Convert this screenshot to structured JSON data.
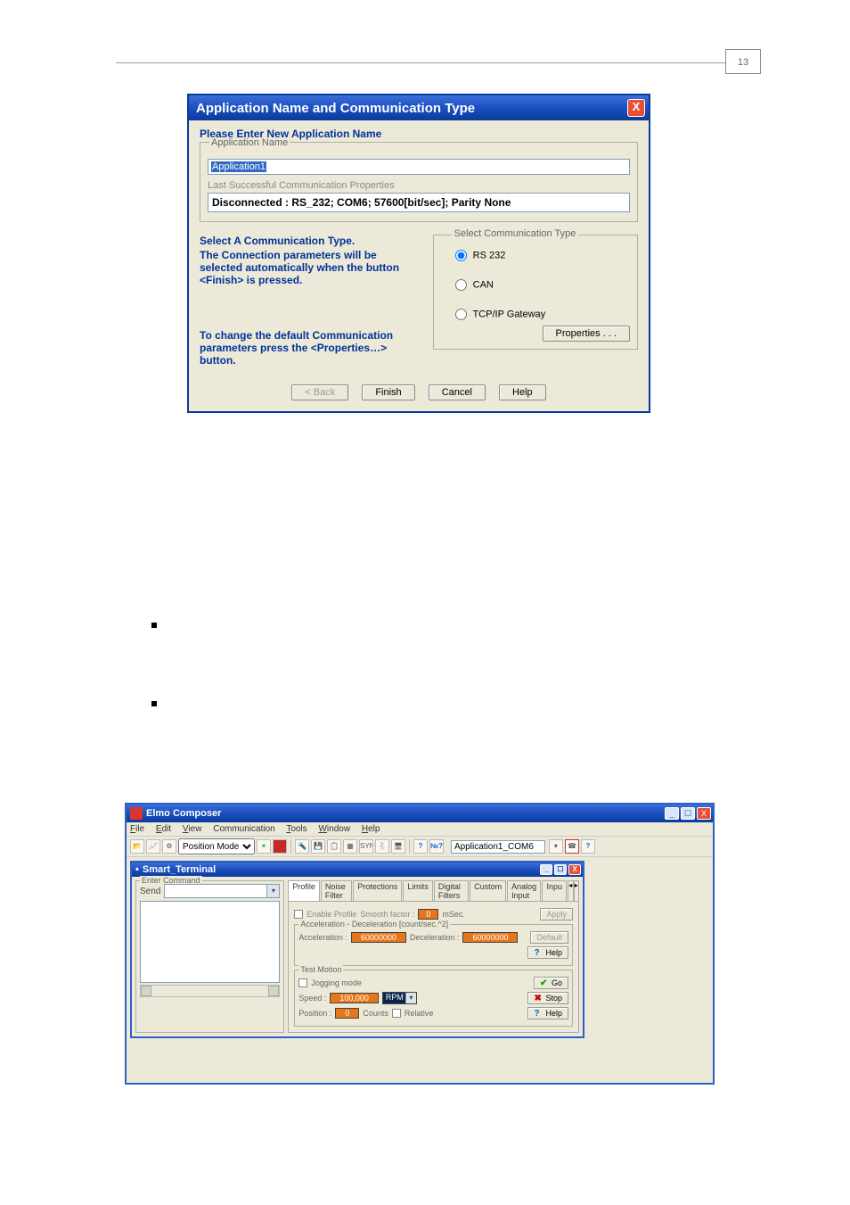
{
  "header": {
    "left_text": "",
    "right_text": "",
    "page_box": "13"
  },
  "dialog1": {
    "title": "Application Name and Communication Type",
    "close": "X",
    "heading": "Please Enter New Application Name",
    "group_app_name": "Application Name",
    "app_name_value": "Application1",
    "last_comm_label": "Last Successful Communication  Properties",
    "conn_status": "Disconnected : RS_232; COM6; 57600[bit/sec]; Parity None",
    "left_text_1": "Select A Communication Type.",
    "left_text_2": "The Connection parameters will be selected automatically when the button <Finish> is pressed.",
    "left_text_3": "To change the default Communication parameters press the <Properties…> button.",
    "group_comm_type": "Select Communication Type",
    "radio_rs232": "RS 232",
    "radio_can": "CAN",
    "radio_tcpip": "TCP/IP Gateway",
    "btn_properties": "Properties . . .",
    "btn_back": "< Back",
    "btn_finish": "Finish",
    "btn_cancel": "Cancel",
    "btn_help": "Help"
  },
  "body_paras": {
    "p1_a": "",
    "p1_b": "",
    "bullet1": "",
    "bullet2": ""
  },
  "mainwin": {
    "title": "Elmo Composer",
    "menus": {
      "file": "File",
      "edit": "Edit",
      "view": "View",
      "comm": "Communication",
      "tools": "Tools",
      "window": "Window",
      "help": "Help"
    },
    "mode_combo": "Position Mode",
    "app_combo": "Application1_COM6",
    "smart_terminal": {
      "title": "Smart_Terminal",
      "enter_cmd_legend": "Enter Command",
      "send_label": "Send"
    },
    "tabs": {
      "profile": "Profile",
      "noise": "Noise Filter",
      "prot": "Protections",
      "limits": "Limits",
      "digf": "Digital Filters",
      "custom": "Custom",
      "analog": "Analog Input",
      "inpu": "Inpu"
    },
    "profile_tab": {
      "enable_profile": "Enable Profile",
      "smooth_factor_label": "Smooth factor :",
      "smooth_factor_value": "0",
      "smooth_unit": "mSec.",
      "apply": "Apply",
      "accel_group": "Acceleration - Deceleration [count/sec.^2]",
      "accel_label": "Acceleration :",
      "accel_value": "60000000",
      "decel_label": "Deceleration :",
      "decel_value": "60000000",
      "help": "Help",
      "default_btn": "Default",
      "test_motion_legend": "Test Motion",
      "jogging_mode": "Jogging mode",
      "speed_label": "Speed :",
      "speed_value": "100,000",
      "speed_unit": "RPM",
      "go_btn": "Go",
      "stop_btn": "Stop",
      "position_label": "Position :",
      "position_value": "0",
      "position_unit": "Counts",
      "relative": "Relative"
    }
  }
}
